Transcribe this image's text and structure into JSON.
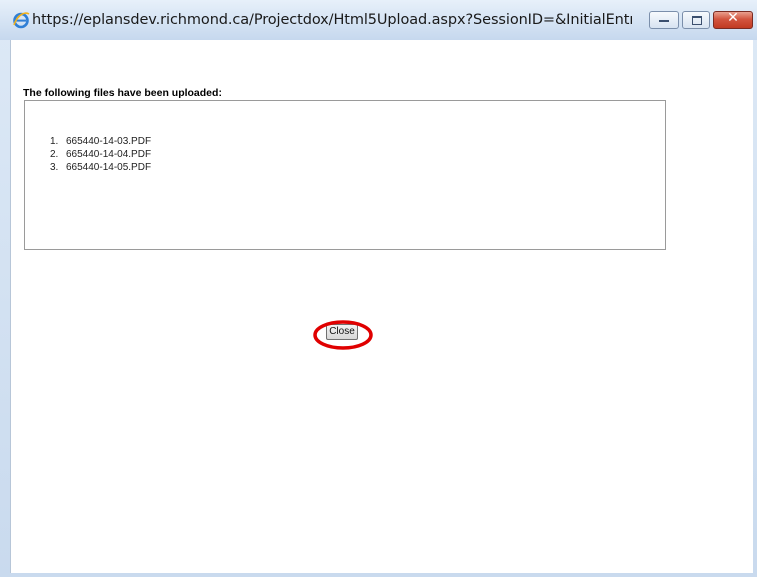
{
  "window": {
    "title": "https://eplansdev.richmond.ca/Projectdox/Html5Upload.aspx?SessionID=&InitialEntry...",
    "browser_icon": "internet-explorer-icon",
    "caption_buttons": {
      "minimize_icon": "minimize-icon",
      "maximize_icon": "maximize-icon",
      "close_icon": "close-icon",
      "close_glyph": "✕"
    }
  },
  "main": {
    "heading": "The following files have been uploaded:",
    "files": [
      {
        "number": "1.",
        "name": "665440-14-03.PDF"
      },
      {
        "number": "2.",
        "name": "665440-14-04.PDF"
      },
      {
        "number": "3.",
        "name": "665440-14-05.PDF"
      }
    ],
    "close_button_label": "Close"
  },
  "colors": {
    "titlebar": "#d3e2f3",
    "highlight_ring": "#e00000",
    "close_caption_button": "#c13a22"
  }
}
